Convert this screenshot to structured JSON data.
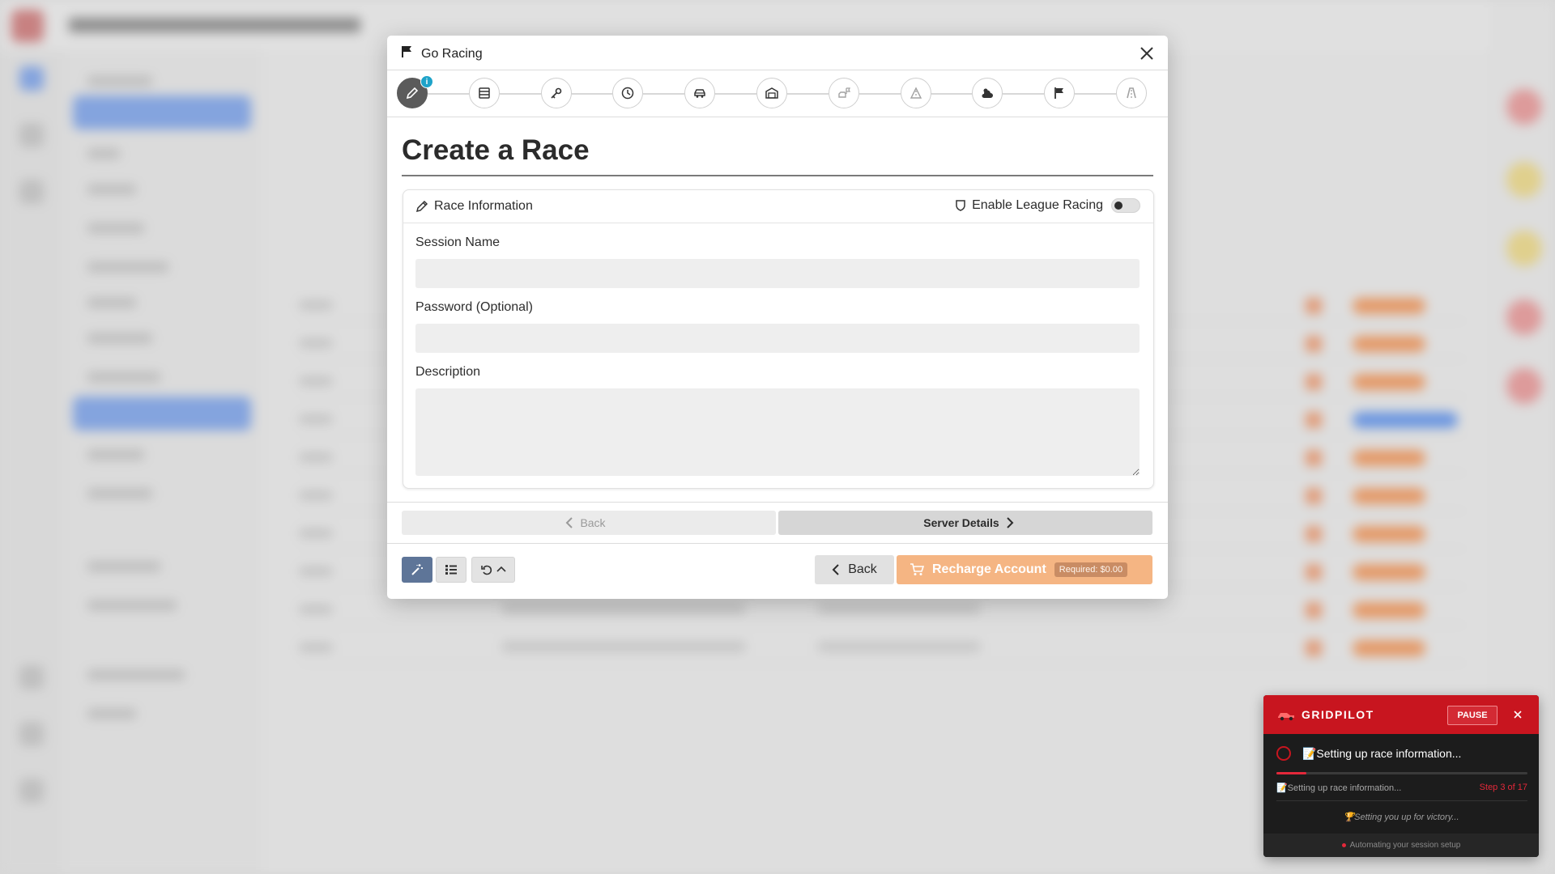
{
  "modal": {
    "title": "Go Racing",
    "heading": "Create a Race",
    "steps": [
      {
        "icon": "pencil-icon",
        "active": true,
        "badge": "i"
      },
      {
        "icon": "server-icon"
      },
      {
        "icon": "key-icon"
      },
      {
        "icon": "clock-icon"
      },
      {
        "icon": "car-icon"
      },
      {
        "icon": "garage-icon"
      },
      {
        "icon": "car-flag-icon"
      },
      {
        "icon": "road-icon"
      },
      {
        "icon": "weather-icon"
      },
      {
        "icon": "flag-icon"
      },
      {
        "icon": "track-icon"
      }
    ],
    "card": {
      "title": "Race Information",
      "league_label": "Enable League Racing",
      "league_enabled": false,
      "fields": {
        "session_name_label": "Session Name",
        "session_name_value": "",
        "password_label": "Password (Optional)",
        "password_value": "",
        "description_label": "Description",
        "description_value": ""
      }
    },
    "nav": {
      "back_label": "Back",
      "next_label": "Server Details"
    },
    "footer": {
      "back_label": "Back",
      "recharge_label": "Recharge Account",
      "required_badge": "Required: $0.00"
    }
  },
  "gridpilot": {
    "title": "GRIDPILOT",
    "pause_label": "PAUSE",
    "status": "📝Setting up race information...",
    "progress": 0.12,
    "substatus": "📝Setting up race information...",
    "step_label": "Step 3 of 17",
    "tagline": "🏆Setting you up for victory...",
    "footer": "Automating your session setup"
  },
  "colors": {
    "accent_orange": "#f5b583",
    "gridpilot_red": "#c8151f",
    "info_badge": "#1ea3c9"
  }
}
